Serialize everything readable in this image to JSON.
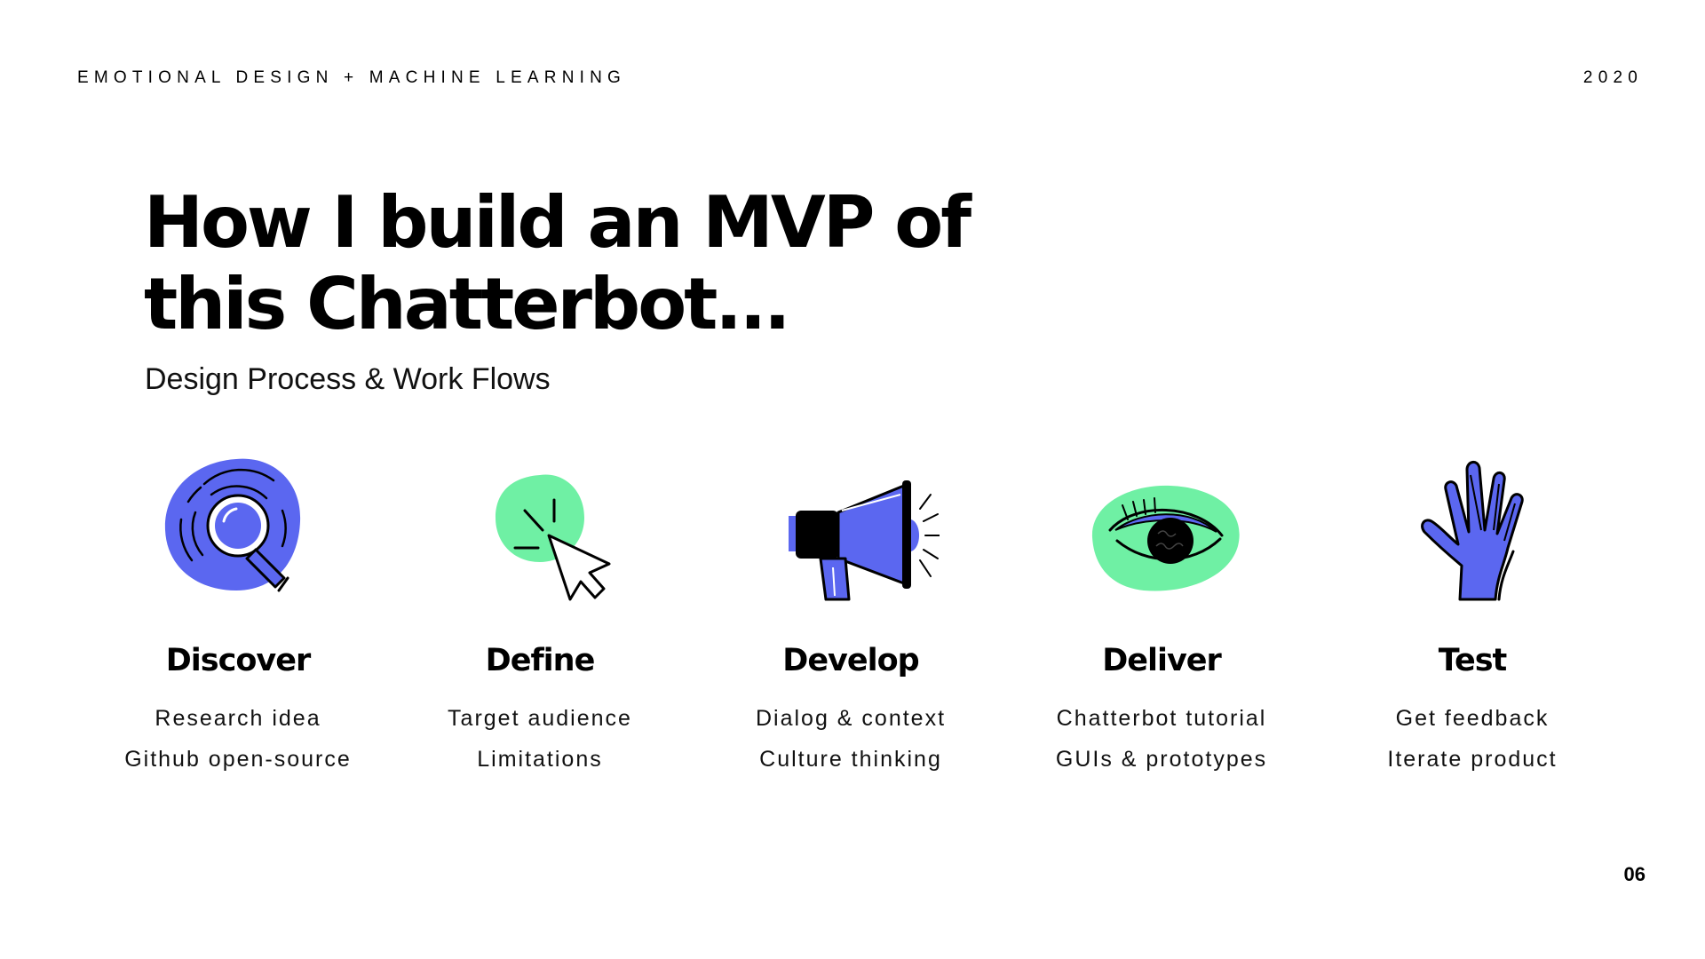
{
  "header": {
    "left_text": "EMOTIONAL DESIGN + MACHINE LEARNING",
    "right_text": "2020"
  },
  "title": {
    "line1": "How I build an MVP of",
    "line2": "this Chatterbot..."
  },
  "subtitle": "Design Process & Work Flows",
  "colors": {
    "accent_blue": "#5B67F0",
    "accent_green": "#6FF0A4",
    "ink": "#000000"
  },
  "steps": [
    {
      "icon": "magnifier-icon",
      "name": "Discover",
      "lines": [
        "Research idea",
        "Github open-source"
      ]
    },
    {
      "icon": "cursor-click-icon",
      "name": "Define",
      "lines": [
        "Target audience",
        "Limitations"
      ]
    },
    {
      "icon": "megaphone-icon",
      "name": "Develop",
      "lines": [
        "Dialog & context",
        "Culture thinking"
      ]
    },
    {
      "icon": "eye-icon",
      "name": "Deliver",
      "lines": [
        "Chatterbot tutorial",
        "GUIs & prototypes"
      ]
    },
    {
      "icon": "hand-icon",
      "name": "Test",
      "lines": [
        "Get feedback",
        "Iterate product"
      ]
    }
  ],
  "page_number": "06"
}
